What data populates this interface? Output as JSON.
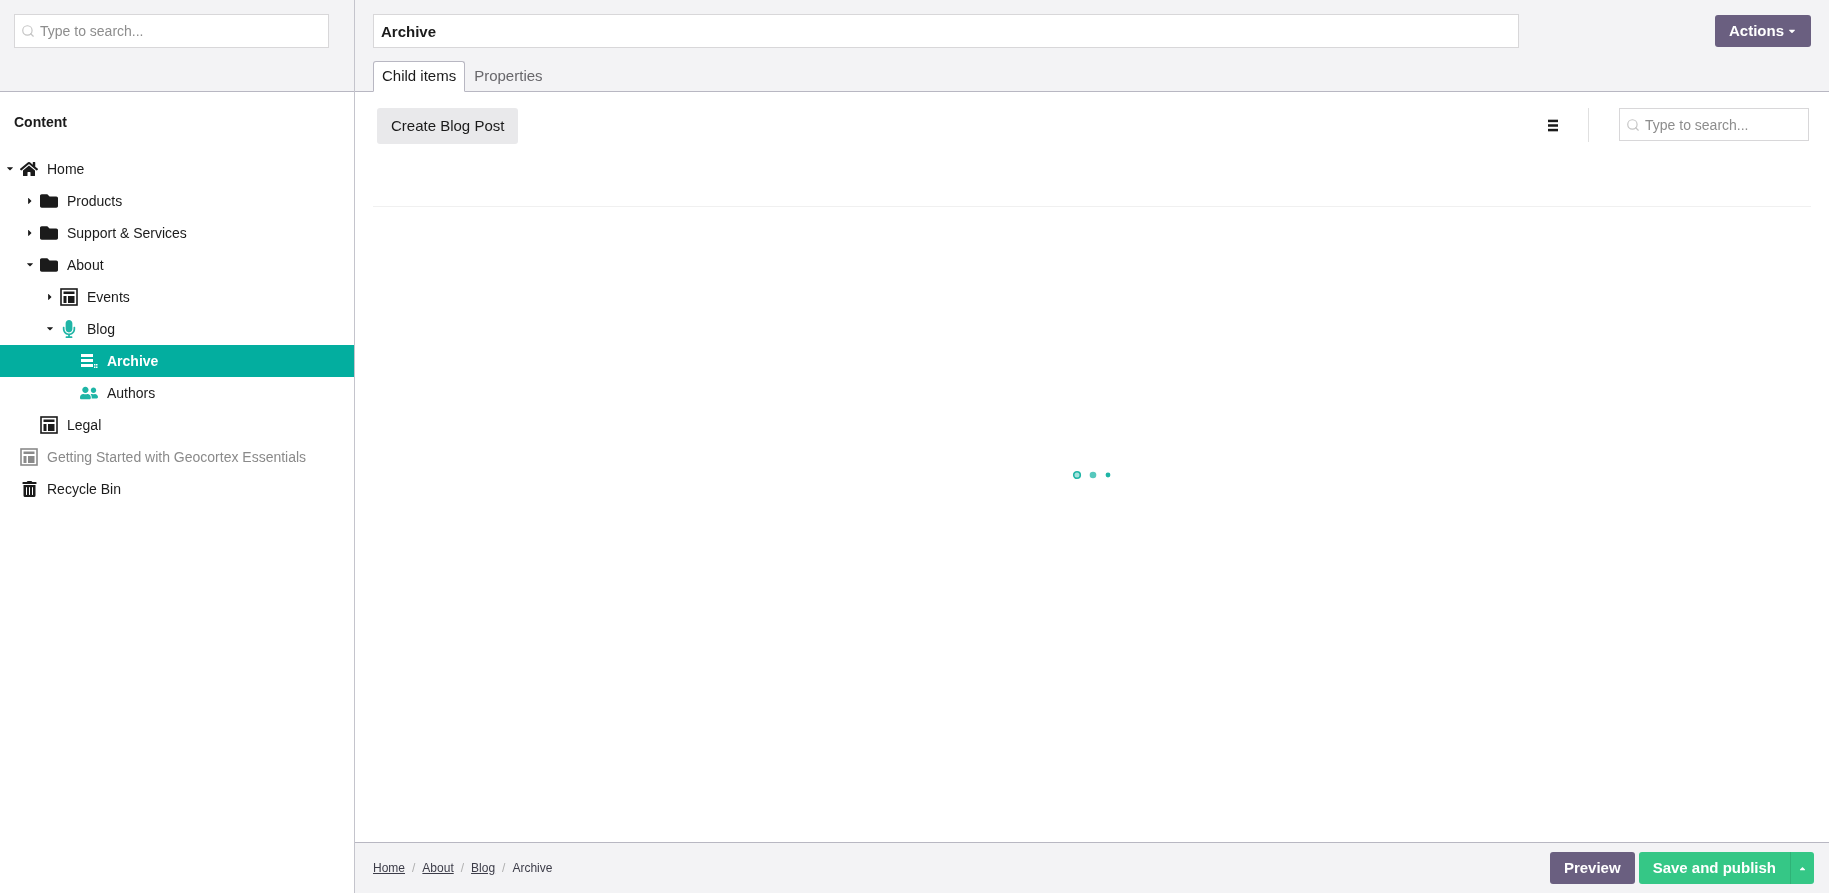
{
  "sidebar": {
    "search": {
      "placeholder": "Type to search..."
    },
    "title": "Content",
    "tree": [
      {
        "label": "Home",
        "kind": "home",
        "expanded": true,
        "selected": false,
        "disabled": false,
        "children": [
          {
            "label": "Products",
            "kind": "folder",
            "expanded": false,
            "selected": false,
            "disabled": false
          },
          {
            "label": "Support & Services",
            "kind": "folder",
            "expanded": false,
            "selected": false,
            "disabled": false
          },
          {
            "label": "About",
            "kind": "folder",
            "expanded": true,
            "selected": false,
            "disabled": false,
            "children": [
              {
                "label": "Events",
                "kind": "page",
                "expanded": false,
                "selected": false,
                "disabled": false
              },
              {
                "label": "Blog",
                "kind": "blog",
                "expanded": true,
                "selected": false,
                "disabled": false,
                "children": [
                  {
                    "label": "Archive",
                    "kind": "archive",
                    "selected": true,
                    "disabled": false
                  },
                  {
                    "label": "Authors",
                    "kind": "authors",
                    "selected": false,
                    "disabled": false
                  }
                ]
              }
            ]
          },
          {
            "label": "Legal",
            "kind": "page",
            "selected": false,
            "disabled": false
          }
        ]
      },
      {
        "label": "Getting Started with Geocortex Essentials",
        "kind": "page",
        "selected": false,
        "disabled": true
      },
      {
        "label": "Recycle Bin",
        "kind": "bin",
        "selected": false,
        "disabled": false
      }
    ]
  },
  "header": {
    "name_field": {
      "value": "Archive"
    },
    "actions_button": "Actions",
    "tabs": [
      {
        "label": "Child items",
        "selected": true
      },
      {
        "label": "Properties",
        "selected": false
      }
    ]
  },
  "toolbar": {
    "create_button": "Create Blog Post",
    "search": {
      "placeholder": "Type to search..."
    }
  },
  "footer": {
    "breadcrumb": [
      {
        "label": "Home",
        "link": true
      },
      {
        "separator": "/",
        "label": "About",
        "link": true
      },
      {
        "separator": "/",
        "label": "Blog",
        "link": true
      },
      {
        "separator": "/",
        "label": "Archive",
        "link": false
      }
    ],
    "preview_button": "Preview",
    "publish_button": "Save and publish"
  }
}
